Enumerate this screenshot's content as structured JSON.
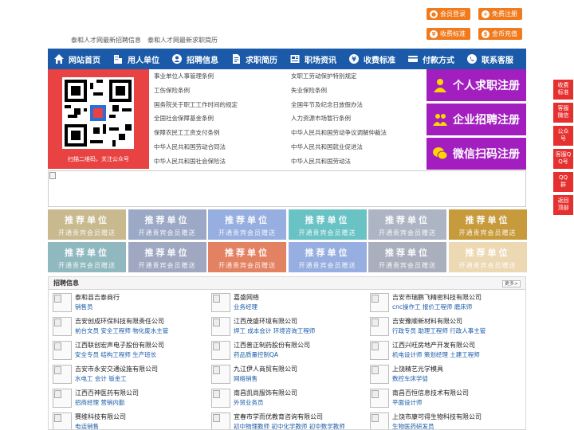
{
  "top_buttons": {
    "member_login": "会员登录",
    "free_register": "免费注册",
    "fee_standard": "收费标准",
    "gold_recharge": "金币充值"
  },
  "top_links": [
    "泰和人才网最新招聘信息",
    "泰和人才网最新求职简历"
  ],
  "nav": [
    {
      "label": "网站首页",
      "icon": "home-icon"
    },
    {
      "label": "用人单位",
      "icon": "building-icon"
    },
    {
      "label": "招聘信息",
      "icon": "recruit-icon"
    },
    {
      "label": "求职简历",
      "icon": "resume-icon"
    },
    {
      "label": "职场资讯",
      "icon": "news-icon"
    },
    {
      "label": "收费标准",
      "icon": "fee-icon"
    },
    {
      "label": "付款方式",
      "icon": "payment-icon"
    },
    {
      "label": "联系客服",
      "icon": "service-icon"
    }
  ],
  "qr_caption": "扫描二维码，关注公众号",
  "policy_links": [
    "事业单位人事管理条例",
    "女职工劳动保护特别规定",
    "工伤保险条例",
    "失业保险条例",
    "国务院关于职工工作时间的规定",
    "全国年节及纪念日放假办法",
    "全国社会保障基金条例",
    "人力资源市场暂行条例",
    "保障农民工工资支付条例",
    "中华人民共和国劳动争议调解仲裁法",
    "中华人民共和国劳动合同法",
    "中华人民共和国就业促进法",
    "中华人民共和国社会保险法",
    "中华人民共和国劳动法"
  ],
  "register": {
    "personal": "个人求职注册",
    "company": "企业招聘注册",
    "wechat": "微信扫码注册"
  },
  "recommend": {
    "title": "推荐单位",
    "sub": "开通贵宾会员赠送",
    "colors": [
      "#c8b98e",
      "#9ba9c6",
      "#96aee0",
      "#69c2c4",
      "#adb5c4",
      "#c79a3c",
      "#8fb8bf",
      "#9fa7c1",
      "#e38262",
      "#96aee0",
      "#aaafbd",
      "#ecd9b3"
    ]
  },
  "jobs": {
    "header": "招聘信息",
    "more": "更多>",
    "items": [
      {
        "company": "泰和县吉泰商行",
        "positions": "销售员"
      },
      {
        "company": "嘉盛网络",
        "positions": "业务经理"
      },
      {
        "company": "吉安市瑞鹏飞精密科技有限公司",
        "positions": "cnc操作工 报价工程师 磨床师"
      },
      {
        "company": "吉安创成环保科技有限责任公司",
        "positions": "前台文员 安全工程师 物化废水主管"
      },
      {
        "company": "江西茂盛环境有限公司",
        "positions": "焊工 成本会计 环境咨询工程师"
      },
      {
        "company": "吉安豫顺新材料有限公司",
        "positions": "行政专员 助理工程师 行政人事主管"
      },
      {
        "company": "江西联创宏声电子股份有限公司",
        "positions": "安全专员 结构工程师 生产班长"
      },
      {
        "company": "江西普正制药股份有限公司",
        "positions": "药品质量控制QA"
      },
      {
        "company": "江西兴旺房地产开发有限公司",
        "positions": "机电设计师 策划经理 土建工程师"
      },
      {
        "company": "吉安市永安交通设施有限公司",
        "positions": "水电工 会计 钣金工"
      },
      {
        "company": "九江伊人商贸有限公司",
        "positions": "网络销售"
      },
      {
        "company": "上饶精艺光学模具",
        "positions": "数控车床学徒"
      },
      {
        "company": "江西百神医药有限公司",
        "positions": "招商经理 营销内勤"
      },
      {
        "company": "南昌凯尚服饰有限公司",
        "positions": "外贸业务员"
      },
      {
        "company": "南昌百恒信息技术有限公司",
        "positions": "平面设计师"
      },
      {
        "company": "赛维科技有限公司",
        "positions": "电话销售"
      },
      {
        "company": "宜春市学而优教育咨询有限公司",
        "positions": "初中物理教师 初中化学教师 初中数学教师"
      },
      {
        "company": "上饶市康可得生物科技有限公司",
        "positions": "生物医药研发员"
      }
    ]
  },
  "side": [
    "收费标准",
    "客服微信",
    "公众号",
    "客服QQ号",
    "QQ群",
    "返回顶部"
  ]
}
